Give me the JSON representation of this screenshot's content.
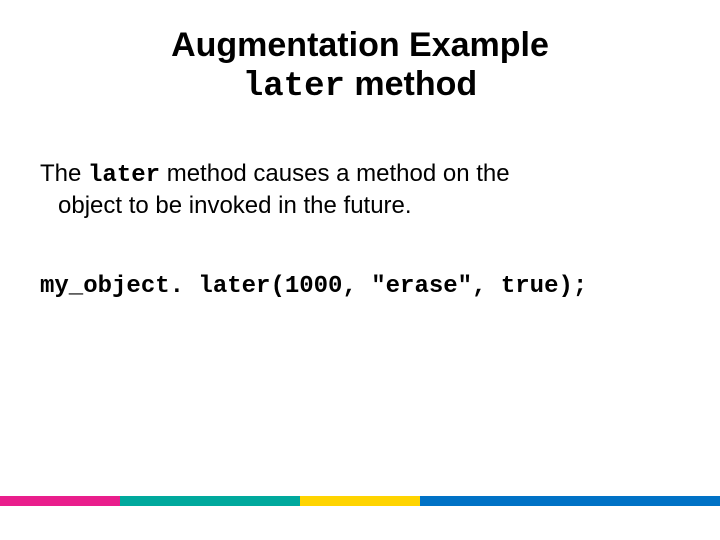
{
  "title": {
    "line1_a": "Augmentation Example",
    "line2_mono": "later",
    "line2_b": " method"
  },
  "paragraph": {
    "pre": "The ",
    "mono": "later",
    "mid": " method causes a method on the",
    "cont": "object to be invoked in the future."
  },
  "code": "my_object. later(1000, \"erase\", true);"
}
